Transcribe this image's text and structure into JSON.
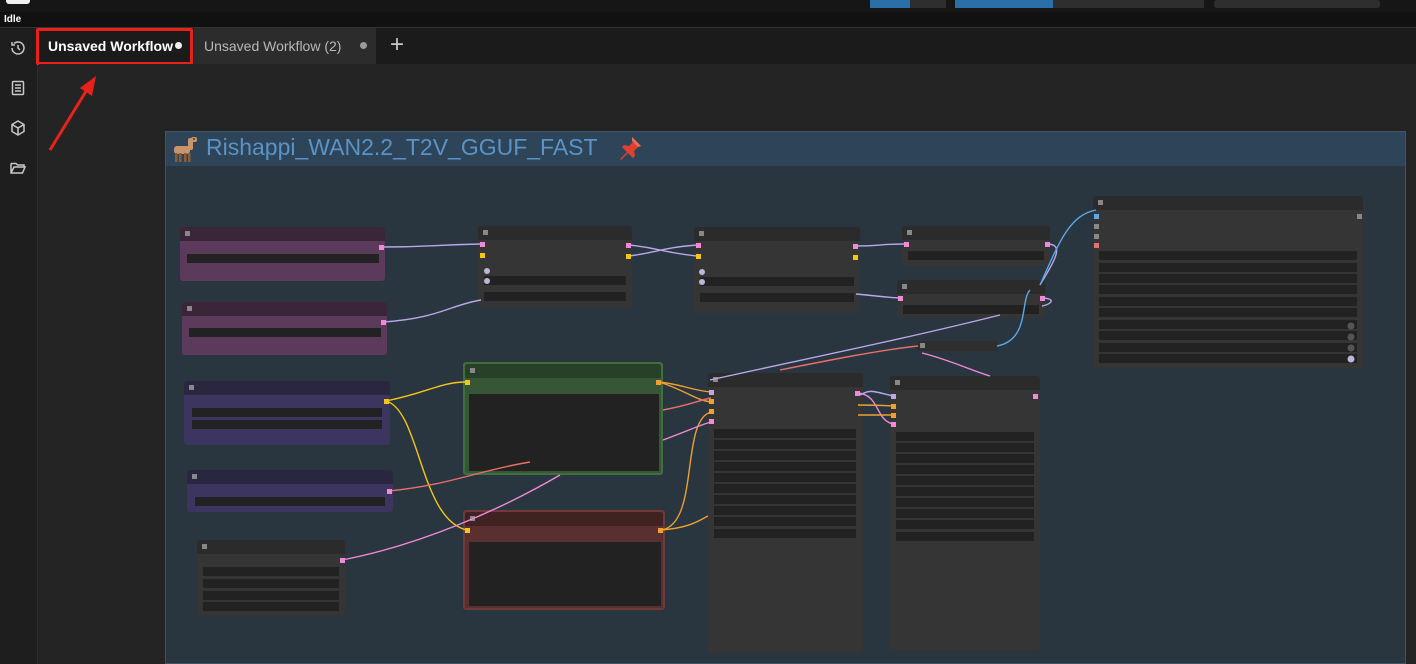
{
  "status": {
    "label": "Idle"
  },
  "tabs": [
    {
      "label": "Unsaved Workflow",
      "active": true
    },
    {
      "label": "Unsaved Workflow (2)",
      "active": false
    }
  ],
  "add_tab_label": "+",
  "group": {
    "title": "Rishappi_WAN2.2_T2V_GGUF_FAST"
  },
  "sidebar": {
    "icons": [
      "history-icon",
      "document-icon",
      "cube-icon",
      "folder-open-icon"
    ]
  },
  "colors": {
    "highlight": "#e8211b",
    "group_header": "#2d4459",
    "group_title": "#5a93c6",
    "link_purple": "#b9a8e8",
    "link_pink": "#f08ad8",
    "link_yellow": "#f5c518",
    "link_orange": "#f0a030",
    "link_blue": "#5aa8e8",
    "link_red": "#e8706a"
  }
}
